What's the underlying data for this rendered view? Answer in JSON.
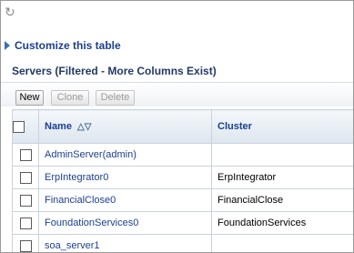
{
  "header": {
    "refresh_icon": "refresh-icon"
  },
  "customize": {
    "label": "Customize this table",
    "icon": "disclosure-triangle-icon"
  },
  "section": {
    "title": "Servers (Filtered - More Columns Exist)"
  },
  "toolbar": {
    "new_label": "New",
    "clone_label": "Clone",
    "delete_label": "Delete"
  },
  "table": {
    "columns": {
      "name": "Name",
      "cluster": "Cluster"
    },
    "sort_icon": "sort-ascending-icon",
    "rows": [
      {
        "name": "AdminServer(admin)",
        "cluster": ""
      },
      {
        "name": "ErpIntegrator0",
        "cluster": "ErpIntegrator"
      },
      {
        "name": "FinancialClose0",
        "cluster": "FinancialClose"
      },
      {
        "name": "FoundationServices0",
        "cluster": "FoundationServices"
      },
      {
        "name": "soa_server1",
        "cluster": ""
      }
    ]
  },
  "colors": {
    "link": "#1b3f8f",
    "header_bg": "#dde6ef",
    "border": "#c9d3de"
  }
}
